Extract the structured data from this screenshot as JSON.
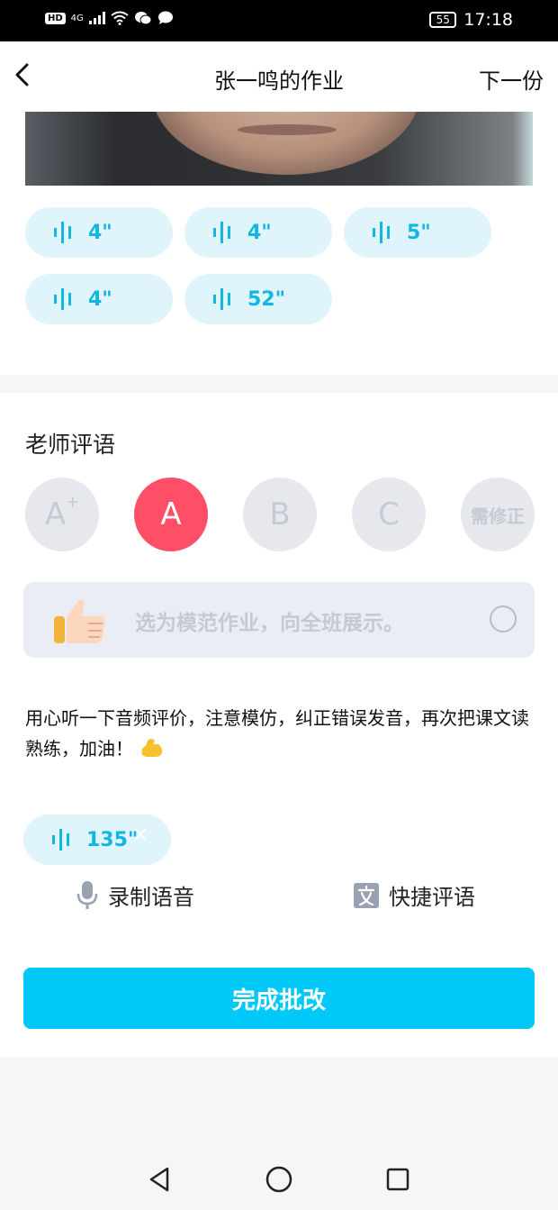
{
  "status_bar": {
    "network": "4G",
    "battery": "55",
    "time": "17:18"
  },
  "header": {
    "title": "张一鸣的作业",
    "next_label": "下一份"
  },
  "audio_clips": [
    {
      "duration": "4\""
    },
    {
      "duration": "4\""
    },
    {
      "duration": "5\""
    },
    {
      "duration": "4\""
    },
    {
      "duration": "52\""
    }
  ],
  "review": {
    "section_title": "老师评语",
    "grades": [
      {
        "label": "A",
        "sup": "+",
        "selected": false
      },
      {
        "label": "A",
        "sup": "",
        "selected": true
      },
      {
        "label": "B",
        "sup": "",
        "selected": false
      },
      {
        "label": "C",
        "sup": "",
        "selected": false
      },
      {
        "label": "需修正",
        "sup": "",
        "selected": false
      }
    ],
    "model_text": "选为模范作业，向全班展示。",
    "comment_text": "用心听一下音频评价，注意模仿，纠正错误发音，再次把课文读熟练，加油！",
    "recorded_voice": "135\"",
    "record_label": "录制语音",
    "quick_label": "快捷评语",
    "submit_label": "完成批改"
  },
  "colors": {
    "accent": "#00c8f8",
    "selected_grade": "#ff4f68",
    "chip_bg": "#e0f4fb",
    "chip_text": "#11b6e3"
  }
}
